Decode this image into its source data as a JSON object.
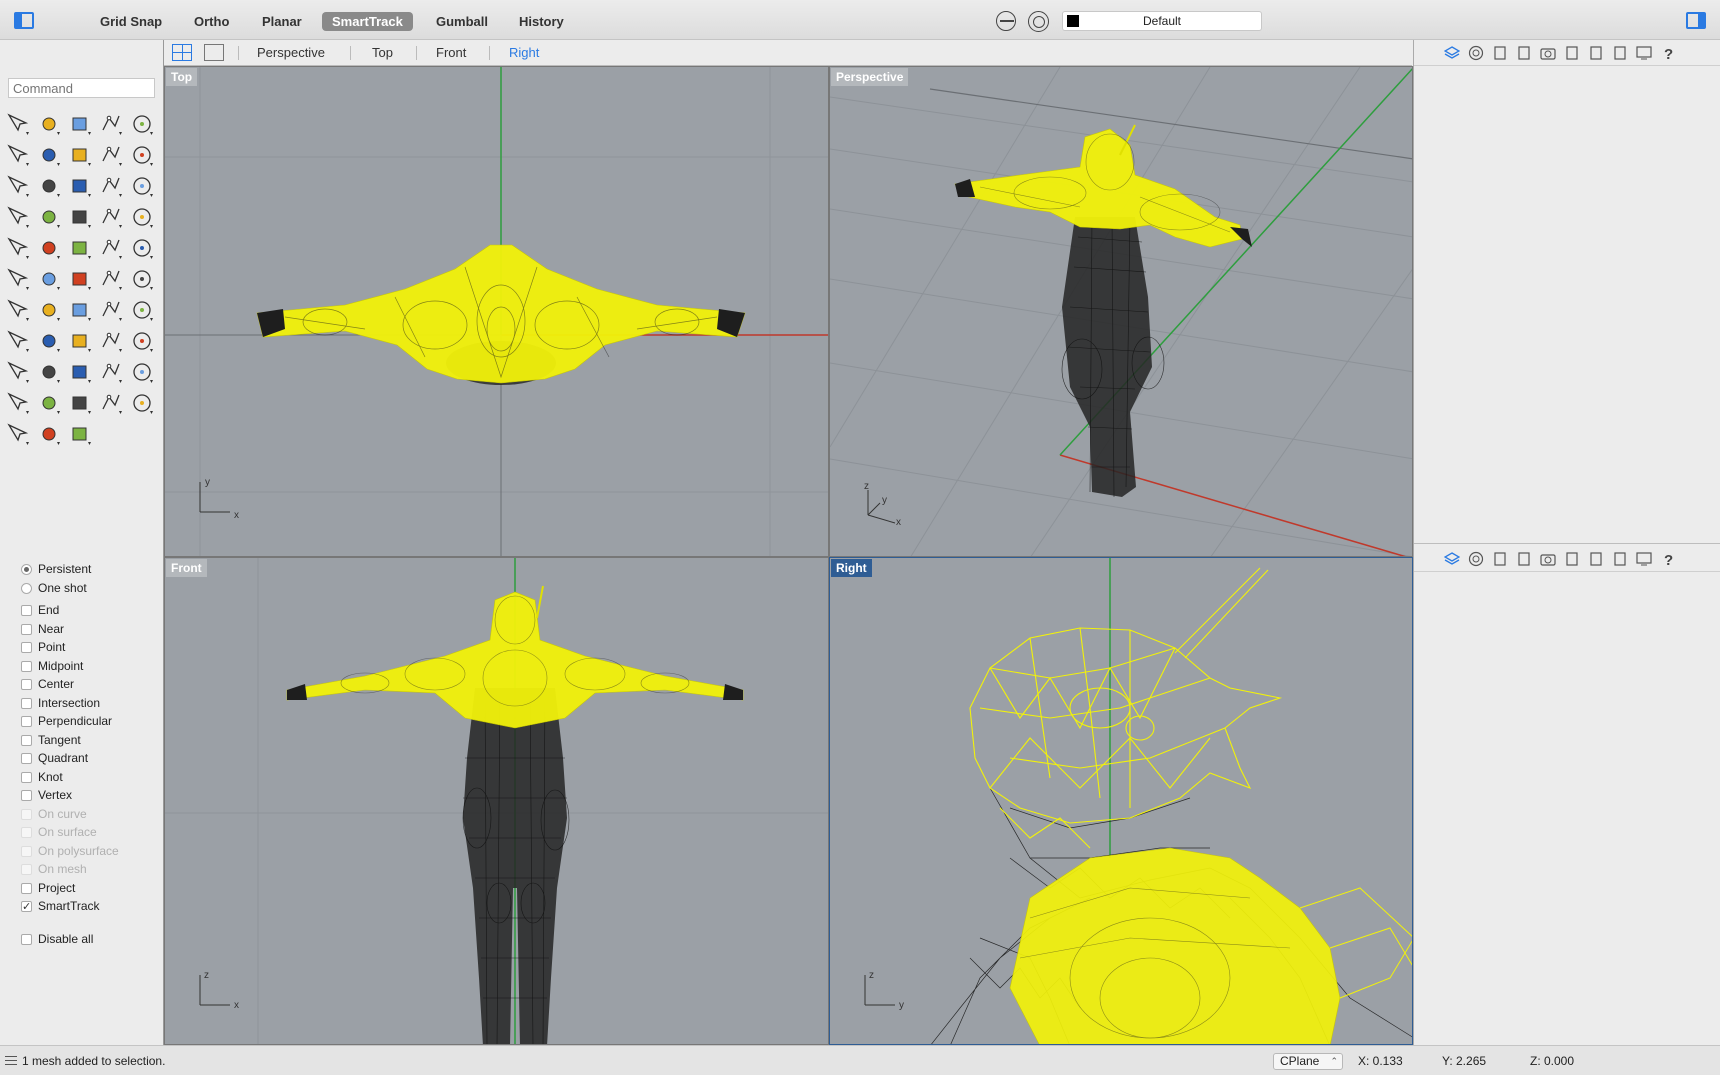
{
  "topbar": {
    "modes": [
      {
        "label": "Grid Snap",
        "active": false
      },
      {
        "label": "Ortho",
        "active": false
      },
      {
        "label": "Planar",
        "active": false
      },
      {
        "label": "SmartTrack",
        "active": true
      },
      {
        "label": "Gumball",
        "active": false
      },
      {
        "label": "History",
        "active": false
      }
    ],
    "layer": "Default",
    "layer_color": "#000000"
  },
  "command": {
    "placeholder": "Command"
  },
  "viewtabs": [
    {
      "label": "Perspective",
      "active": false
    },
    {
      "label": "Top",
      "active": false
    },
    {
      "label": "Front",
      "active": false
    },
    {
      "label": "Right",
      "active": true
    }
  ],
  "viewports": {
    "top": {
      "label": "Top",
      "axes": [
        "y",
        "x"
      ]
    },
    "perspective": {
      "label": "Perspective",
      "axes": [
        "z",
        "y",
        "x"
      ]
    },
    "front": {
      "label": "Front",
      "axes": [
        "z",
        "x"
      ]
    },
    "right": {
      "label": "Right",
      "axes": [
        "z",
        "y"
      ],
      "active": true
    }
  },
  "osnap": {
    "mode": [
      {
        "label": "Persistent",
        "checked": true
      },
      {
        "label": "One shot",
        "checked": false
      }
    ],
    "snaps": [
      {
        "label": "End",
        "checked": false,
        "enabled": true
      },
      {
        "label": "Near",
        "checked": false,
        "enabled": true
      },
      {
        "label": "Point",
        "checked": false,
        "enabled": true
      },
      {
        "label": "Midpoint",
        "checked": false,
        "enabled": true
      },
      {
        "label": "Center",
        "checked": false,
        "enabled": true
      },
      {
        "label": "Intersection",
        "checked": false,
        "enabled": true
      },
      {
        "label": "Perpendicular",
        "checked": false,
        "enabled": true
      },
      {
        "label": "Tangent",
        "checked": false,
        "enabled": true
      },
      {
        "label": "Quadrant",
        "checked": false,
        "enabled": true
      },
      {
        "label": "Knot",
        "checked": false,
        "enabled": true
      },
      {
        "label": "Vertex",
        "checked": false,
        "enabled": true
      },
      {
        "label": "On curve",
        "checked": false,
        "enabled": false
      },
      {
        "label": "On surface",
        "checked": false,
        "enabled": false
      },
      {
        "label": "On polysurface",
        "checked": false,
        "enabled": false
      },
      {
        "label": "On mesh",
        "checked": false,
        "enabled": false
      },
      {
        "label": "Project",
        "checked": false,
        "enabled": true
      },
      {
        "label": "SmartTrack",
        "checked": true,
        "enabled": true
      }
    ],
    "disable_all": "Disable all"
  },
  "right_panel_icons": [
    "layers-icon",
    "materials-icon",
    "document-icon",
    "object-icon",
    "camera-icon",
    "render-icon",
    "notes-icon",
    "frame-icon",
    "display-icon",
    "help-icon"
  ],
  "status": {
    "message": "1 mesh added to selection.",
    "cplane": "CPlane",
    "x": "X: 0.133",
    "y": "Y: 2.265",
    "z": "Z: 0.000"
  },
  "colors": {
    "accent": "#2a7ae2",
    "selected_mesh": "#ffff00",
    "mesh": "#111111",
    "viewport_bg": "#9ba0a6",
    "x_axis": "#c0392b",
    "y_axis": "#2e9e3e"
  }
}
